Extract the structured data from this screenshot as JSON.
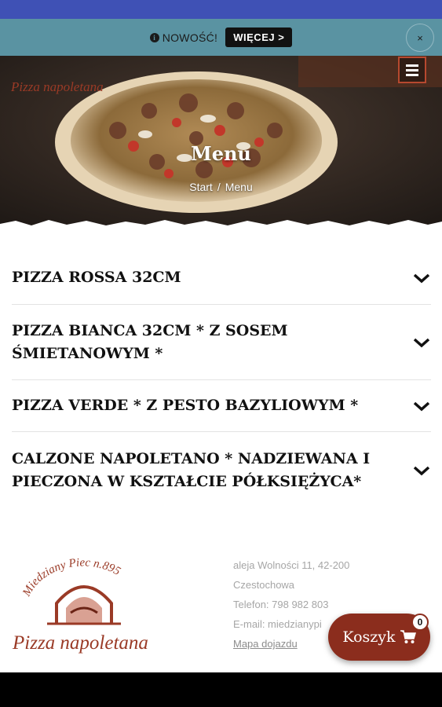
{
  "notice": {
    "text": "NOWOŚĆ!",
    "button_label": "WIĘCEJ >",
    "close_label": "×"
  },
  "header": {
    "logo_text": "Pizza napoletana",
    "title": "Menu",
    "breadcrumb": {
      "home": "Start",
      "separator": "/",
      "current": "Menu"
    }
  },
  "menu_categories": [
    {
      "title": "PIZZA ROSSA 32CM"
    },
    {
      "title": "PIZZA BIANCA 32CM * Z SOSEM ŚMIETANOWYM *"
    },
    {
      "title": "PIZZA VERDE * Z PESTO BAZYLIOWYM *"
    },
    {
      "title": "CALZONE NAPOLETANO * NADZIEWANA I PIECZONA W KSZTAŁCIE PÓŁKSIĘŻYCA*"
    }
  ],
  "footer": {
    "logo_arc_text": "Miedziany Piec n.895",
    "logo_script_text": "Pizza napoletana",
    "address_line1": "aleja Wolności 11, 42-200",
    "address_line2": "Czestochowa",
    "phone": "Telefon: 798 982 803",
    "email": "E-mail: miedzianypi",
    "map_link": "Mapa dojazdu"
  },
  "cart": {
    "label": "Koszyk",
    "count": "0"
  },
  "colors": {
    "status_bar": "#3f51b5",
    "notice_bar": "#5a93a2",
    "brand_red": "#8b2d1d",
    "text_dark": "#111111"
  },
  "icons": {
    "info": "info-icon",
    "menu": "hamburger-menu-icon",
    "expand": "chevron-down-icon",
    "cart": "shopping-cart-icon"
  }
}
